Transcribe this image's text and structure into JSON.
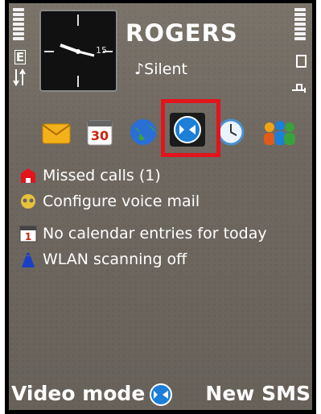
{
  "status": {
    "operator": "ROGERS",
    "profile": "Silent",
    "clock_hour_label": "15",
    "signal_label": "E"
  },
  "shortcuts": [
    {
      "name": "messaging",
      "icon": "envelope-icon"
    },
    {
      "name": "calendar",
      "icon": "calendar-icon",
      "label": "30"
    },
    {
      "name": "web",
      "icon": "globe-icon"
    },
    {
      "name": "video-call",
      "icon": "video-call-icon",
      "selected": true
    },
    {
      "name": "clock",
      "icon": "clock-icon"
    },
    {
      "name": "contacts",
      "icon": "contacts-icon"
    }
  ],
  "notifications": [
    {
      "icon": "missed-call-icon",
      "label": "Missed calls (1)"
    },
    {
      "icon": "voicemail-icon",
      "label": "Configure voice mail"
    },
    {
      "icon": "calendar-small-icon",
      "label": "No calendar entries for today"
    },
    {
      "icon": "wlan-icon",
      "label": "WLAN scanning off"
    }
  ],
  "softkeys": {
    "left": "Video mode",
    "right": "New SMS"
  },
  "colors": {
    "highlight": "#e2141c",
    "background": "#6e6860",
    "text": "#ffffff"
  }
}
